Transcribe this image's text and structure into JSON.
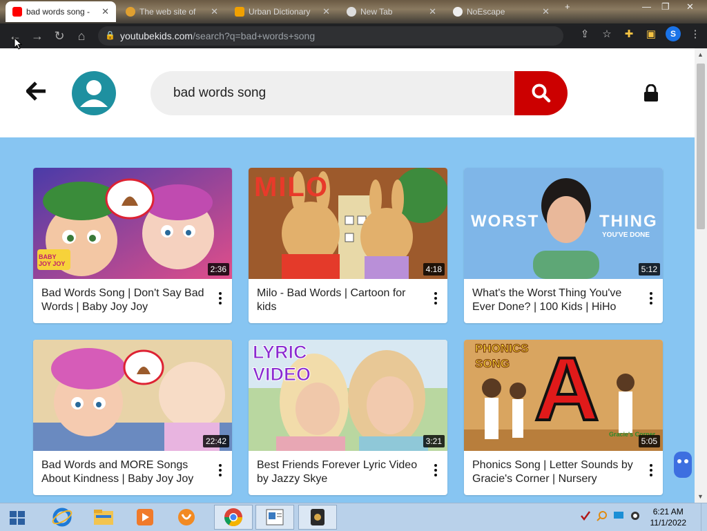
{
  "browser": {
    "tabs": [
      {
        "title": "bad words song -",
        "active": true,
        "favicon": "youtube-kids-icon"
      },
      {
        "title": "The web site of",
        "active": false,
        "favicon": "pumpkin-icon"
      },
      {
        "title": "Urban Dictionary",
        "active": false,
        "favicon": "ud-icon"
      },
      {
        "title": "New Tab",
        "active": false,
        "favicon": "chrome-icon"
      },
      {
        "title": "NoEscape",
        "active": false,
        "favicon": "github-icon"
      }
    ],
    "url_host": "youtubekids.com",
    "url_path": "/search?q=bad+words+song",
    "profile_initial": "S"
  },
  "header": {
    "search_value": "bad words song"
  },
  "videos": [
    {
      "title": "Bad Words Song | Don't Say Bad Words | Baby Joy Joy",
      "duration": "2:36"
    },
    {
      "title": "Milo - Bad Words | Cartoon for kids",
      "duration": "4:18"
    },
    {
      "title": "What's the Worst Thing You've Ever Done? | 100 Kids | HiHo Kids",
      "duration": "5:12"
    },
    {
      "title": "Bad Words and MORE Songs About Kindness | Baby Joy Joy",
      "duration": "22:42"
    },
    {
      "title": "Best Friends Forever Lyric Video by Jazzy Skye",
      "duration": "3:21"
    },
    {
      "title": "Phonics Song | Letter Sounds by Gracie's Corner | Nursery Rhyme...",
      "duration": "5:05"
    }
  ],
  "thumbnail_text": {
    "milo": "MILO",
    "worst": "WORST",
    "thing": "THING",
    "youve_done": "YOU'VE DONE",
    "lyric": "LYRIC",
    "video": "VIDEO",
    "phonics": "PHONICS",
    "song": "SONG",
    "letter": "A",
    "gracie": "Gracie's Corner",
    "babyjoyjoy": "BABY JOY JOY"
  },
  "taskbar": {
    "time": "6:21 AM",
    "date": "11/1/2022"
  },
  "colors": {
    "page_bg": "#87c5f2",
    "search_button": "#cc0000",
    "profile": "#1e90a0"
  }
}
